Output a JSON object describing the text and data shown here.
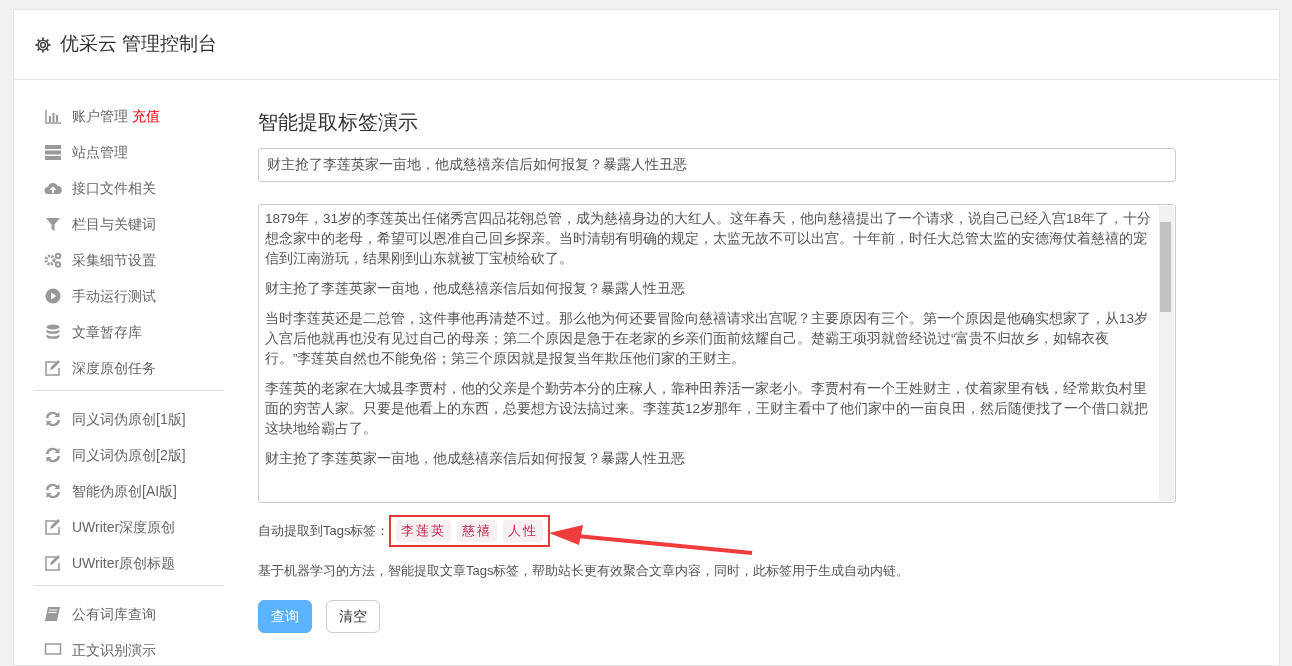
{
  "header": {
    "title": "优采云 管理控制台"
  },
  "sidebar": {
    "groups": [
      {
        "items": [
          {
            "label": "账户管理",
            "badge": "充值"
          },
          {
            "label": "站点管理"
          },
          {
            "label": "接口文件相关"
          },
          {
            "label": "栏目与关键词"
          },
          {
            "label": "采集细节设置"
          },
          {
            "label": "手动运行测试"
          },
          {
            "label": "文章暂存库"
          },
          {
            "label": "深度原创任务"
          }
        ]
      },
      {
        "items": [
          {
            "label": "同义词伪原创[1版]"
          },
          {
            "label": "同义词伪原创[2版]"
          },
          {
            "label": "智能伪原创[AI版]"
          },
          {
            "label": "UWriter深度原创"
          },
          {
            "label": "UWriter原创标题"
          }
        ]
      },
      {
        "items": [
          {
            "label": "公有词库查询"
          },
          {
            "label": "正文识别演示"
          }
        ]
      }
    ]
  },
  "main": {
    "heading": "智能提取标签演示",
    "title_field": {
      "value": "财主抢了李莲英家一亩地，他成慈禧亲信后如何报复？暴露人性丑恶"
    },
    "body_field": {
      "paragraphs": [
        "1879年，31岁的李莲英出任储秀宫四品花翎总管，成为慈禧身边的大红人。这年春天，他向慈禧提出了一个请求，说自己已经入宫18年了，十分想念家中的老母，希望可以恩准自己回乡探亲。当时清朝有明确的规定，太监无故不可以出宫。十年前，时任大总管太监的安德海仗着慈禧的宠信到江南游玩，结果刚到山东就被丁宝桢给砍了。",
        "财主抢了李莲英家一亩地，他成慈禧亲信后如何报复？暴露人性丑恶",
        "当时李莲英还是二总管，这件事他再清楚不过。那么他为何还要冒险向慈禧请求出宫呢？主要原因有三个。第一个原因是他确实想家了，从13岁入宫后他就再也没有见过自己的母亲；第二个原因是急于在老家的乡亲们面前炫耀自己。楚霸王项羽就曾经说过“富贵不归故乡，如锦衣夜行。”李莲英自然也不能免俗；第三个原因就是报复当年欺压他们家的王财主。",
        "李莲英的老家在大城县李贾村，他的父亲是个勤劳本分的庄稼人，靠种田养活一家老小。李贾村有一个王姓财主，仗着家里有钱，经常欺负村里面的穷苦人家。只要是他看上的东西，总要想方设法搞过来。李莲英12岁那年，王财主看中了他们家中的一亩良田，然后随便找了一个借口就把这块地给霸占了。",
        "财主抢了李莲英家一亩地，他成慈禧亲信后如何报复？暴露人性丑恶"
      ]
    },
    "tags_label": "自动提取到Tags标签：",
    "tags": [
      "李莲英",
      "慈禧",
      "人性"
    ],
    "description": "基于机器学习的方法，智能提取文章Tags标签，帮助站长更有效聚合文章内容，同时，此标签用于生成自动内链。",
    "buttons": [
      {
        "label": "查询",
        "kind": "primary"
      },
      {
        "label": "清空",
        "kind": "plain"
      }
    ]
  }
}
